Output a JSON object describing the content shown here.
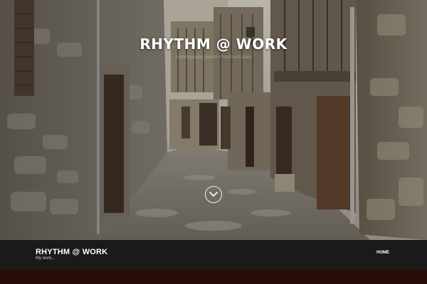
{
  "hero": {
    "title": "RHYTHM @ WORK",
    "tagline": "A photography journal of craft and place",
    "image_description": "narrow cobblestone street between old stone and timber-framed houses",
    "scroll_icon": "chevron-down-icon"
  },
  "header": {
    "site_title": "RHYTHM @ WORK",
    "site_tagline": "My work..."
  },
  "nav": {
    "items": [
      {
        "label": "HOME"
      }
    ]
  },
  "colors": {
    "navbar_bg": "#1a1a1a",
    "footer_strip": "#2a0d07",
    "title_text": "#ffffff"
  }
}
